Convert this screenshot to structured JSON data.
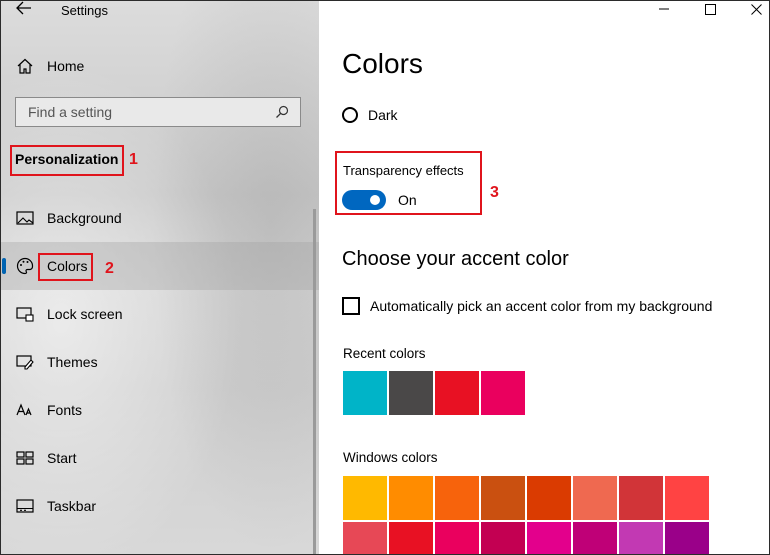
{
  "window": {
    "title": "Settings"
  },
  "sidebar": {
    "home_label": "Home",
    "search_placeholder": "Find a setting",
    "section_title": "Personalization",
    "items": [
      {
        "label": "Background",
        "icon": "image-icon"
      },
      {
        "label": "Colors",
        "icon": "palette-icon",
        "selected": true
      },
      {
        "label": "Lock screen",
        "icon": "lock-screen-icon"
      },
      {
        "label": "Themes",
        "icon": "themes-icon"
      },
      {
        "label": "Fonts",
        "icon": "fonts-icon"
      },
      {
        "label": "Start",
        "icon": "start-icon"
      },
      {
        "label": "Taskbar",
        "icon": "taskbar-icon"
      }
    ]
  },
  "annotations": {
    "n1": "1",
    "n2": "2",
    "n3": "3"
  },
  "main": {
    "title": "Colors",
    "dark_label": "Dark",
    "transparency_label": "Transparency effects",
    "transparency_state": "On",
    "accent_title": "Choose your accent color",
    "auto_pick_label": "Automatically pick an accent color from my background",
    "recent_label": "Recent colors",
    "windows_label": "Windows colors",
    "recent_colors": [
      "#00b4c8",
      "#4a4848",
      "#e81123",
      "#ea005e"
    ],
    "windows_colors_row1": [
      "#ffb900",
      "#ff8c00",
      "#f7630c",
      "#ca5010",
      "#da3b01",
      "#ef6950",
      "#d13438",
      "#ff4343"
    ],
    "windows_colors_row2": [
      "#e74856",
      "#e81123",
      "#ea005e",
      "#c30052",
      "#e3008c",
      "#bf0077",
      "#c239b3",
      "#9a0089"
    ]
  },
  "colors": {
    "accent": "#0067c0",
    "annotation": "#e0141c"
  }
}
